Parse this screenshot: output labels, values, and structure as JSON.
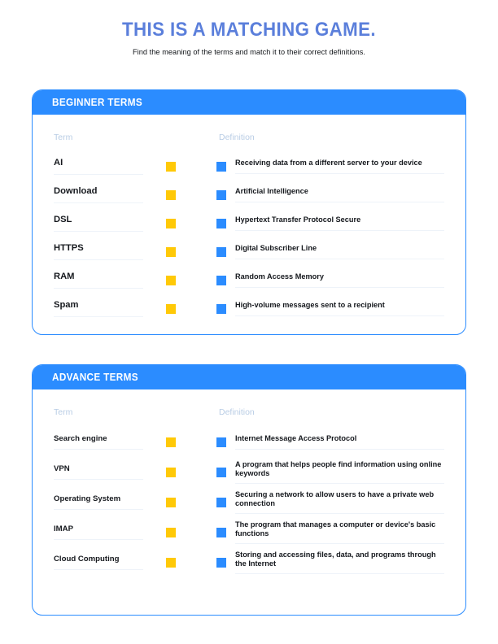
{
  "page": {
    "title": "THIS IS A MATCHING GAME.",
    "subtitle": "Find the meaning of the terms and match it to their correct definitions."
  },
  "colors": {
    "title_blue": "#5b7fdb",
    "accent_blue": "#2b8cff",
    "accent_yellow": "#ffc907",
    "underline": "#eef3f9",
    "column_label": "#b9cde5",
    "text": "#15181d",
    "background": "#ffffff"
  },
  "cards": [
    {
      "header": "BEGINNER TERMS",
      "columns": {
        "term": "Term",
        "definition": "Definition"
      },
      "rows": [
        {
          "term": "AI",
          "definition": "Receiving data from a different server to your device"
        },
        {
          "term": "Download",
          "definition": "Artificial Intelligence"
        },
        {
          "term": "DSL",
          "definition": "Hypertext Transfer Protocol Secure"
        },
        {
          "term": "HTTPS",
          "definition": "Digital Subscriber Line"
        },
        {
          "term": "RAM",
          "definition": "Random Access Memory"
        },
        {
          "term": "Spam",
          "definition": "High-volume messages sent to a recipient"
        }
      ]
    },
    {
      "header": "ADVANCE TERMS",
      "columns": {
        "term": "Term",
        "definition": "Definition"
      },
      "rows": [
        {
          "term": "Search engine",
          "definition": "Internet Message Access Protocol"
        },
        {
          "term": "VPN",
          "definition": "A program that helps people find information using online keywords"
        },
        {
          "term": "Operating System",
          "definition": "Securing a network to allow users to have a private web connection"
        },
        {
          "term": "IMAP",
          "definition": "The program that manages a computer or device's basic functions"
        },
        {
          "term": "Cloud Computing",
          "definition": "Storing and accessing files, data, and programs through the Internet"
        }
      ]
    }
  ]
}
